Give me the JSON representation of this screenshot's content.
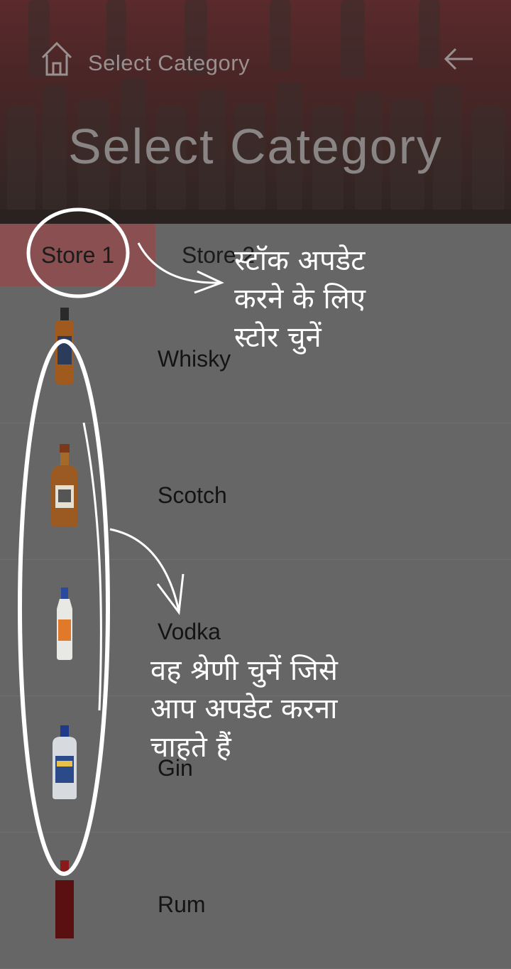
{
  "header": {
    "home_icon": "home-icon",
    "title": "Select Category",
    "back_icon": "arrow-left-icon",
    "hero_title": "Select Category"
  },
  "tabs": [
    {
      "label": "Store 1",
      "selected": true
    },
    {
      "label": "Store 2",
      "selected": false
    }
  ],
  "categories": [
    {
      "label": "Whisky",
      "icon": "whisky-bottle-icon"
    },
    {
      "label": "Scotch",
      "icon": "scotch-bottle-icon"
    },
    {
      "label": "Vodka",
      "icon": "vodka-bottle-icon"
    },
    {
      "label": "Gin",
      "icon": "gin-bottle-icon"
    },
    {
      "label": "Rum",
      "icon": "rum-bottle-icon"
    }
  ],
  "annotations": {
    "store_hint": "स्टॉक अपडेट करने के लिए स्टोर चुनें",
    "category_hint": "वह श्रेणी चुनें जिसे आप अपडेट करना चाहते हैं"
  },
  "colors": {
    "selected_tab": "#8a5051",
    "list_background": "#666666",
    "annotation": "#ffffff"
  }
}
